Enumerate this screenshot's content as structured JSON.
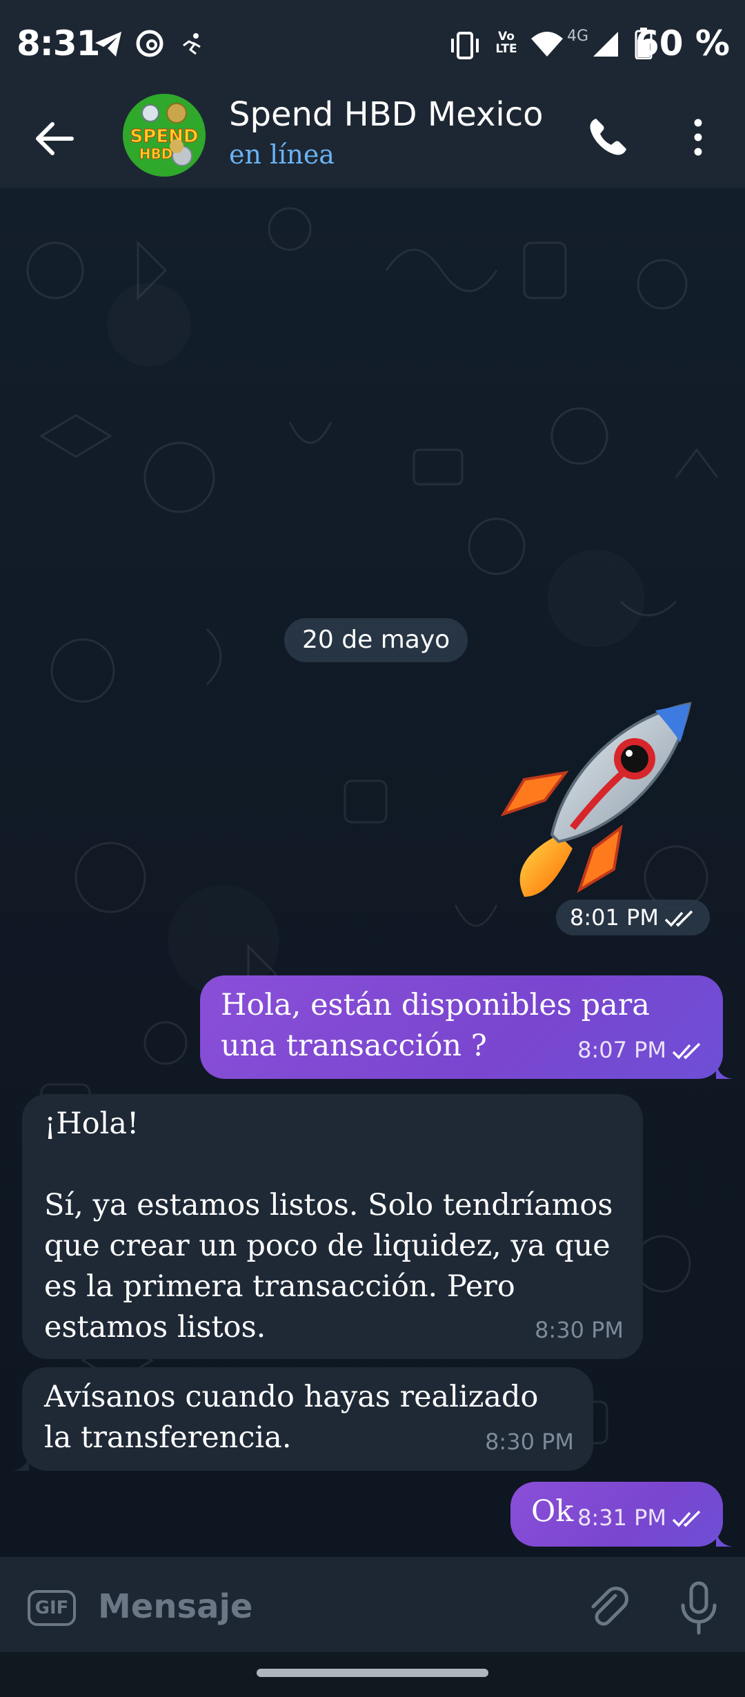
{
  "status_bar": {
    "time": "8:31",
    "battery_text": "60 %",
    "network_label": "4G",
    "volte_label": "Vo LTE",
    "icons": [
      "telegram-icon",
      "threads-icon",
      "activity-icon",
      "vibrate-icon",
      "volte-icon",
      "wifi-icon",
      "signal-icon",
      "battery-icon"
    ]
  },
  "header": {
    "title": "Spend HBD Mexico",
    "status": "en línea",
    "avatar_text": "SPEND HBD",
    "accent_color": "#6ab3f3"
  },
  "chat": {
    "date_label": "20 de mayo",
    "messages": [
      {
        "type": "sticker",
        "emoji": "rocket",
        "time": "8:01 PM",
        "read": true,
        "outgoing": true
      },
      {
        "type": "text",
        "text": "Hola, están disponibles para una transacción ?",
        "time": "8:07 PM",
        "read": true,
        "outgoing": true
      },
      {
        "type": "text",
        "text": "¡Hola!\n\nSí, ya estamos listos. Solo tendríamos que crear un poco de liquidez, ya que es la primera transacción. Pero estamos listos.",
        "time": "8:30 PM",
        "outgoing": false
      },
      {
        "type": "text",
        "text": "Avísanos cuando hayas realizado la transferencia.",
        "time": "8:30 PM",
        "outgoing": false
      },
      {
        "type": "text",
        "text": "Ok",
        "time": "8:31 PM",
        "read": true,
        "outgoing": true
      }
    ],
    "outgoing_color": "#7b46d0",
    "incoming_color": "#1f2936"
  },
  "composer": {
    "placeholder": "Mensaje",
    "gif_label": "GIF"
  }
}
